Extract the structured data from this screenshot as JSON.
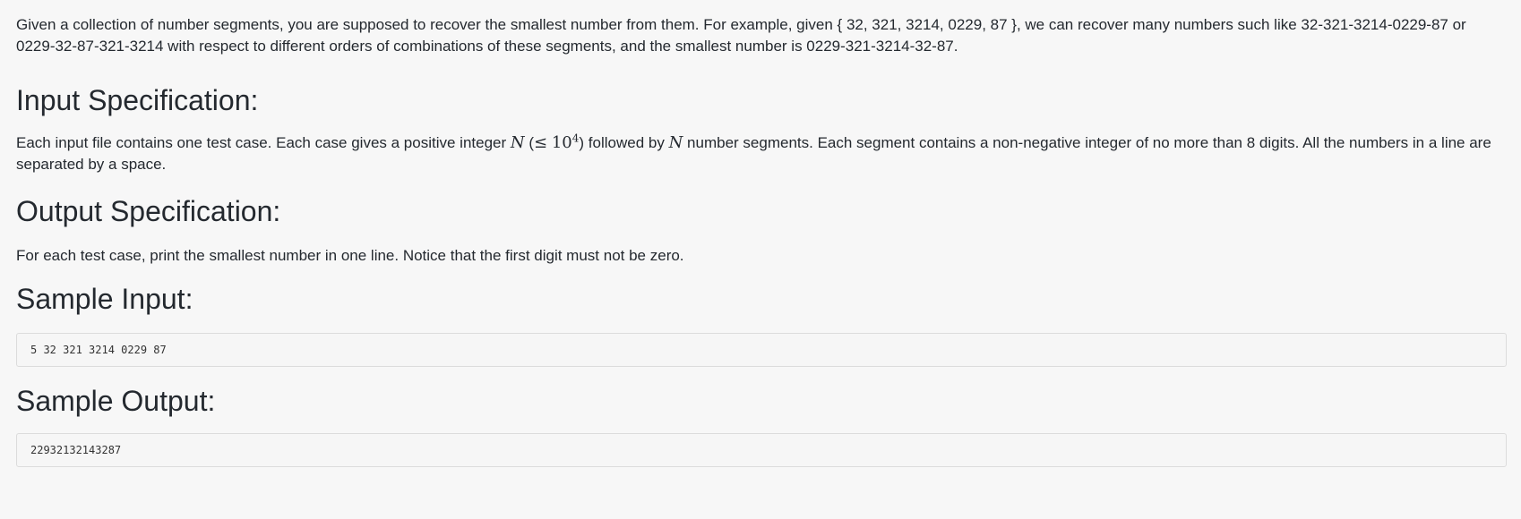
{
  "intro": "Given a collection of number segments, you are supposed to recover the smallest number from them. For example, given { 32, 321, 3214, 0229, 87 }, we can recover many numbers such like 32-321-3214-0229-87 or 0229-32-87-321-3214 with respect to different orders of combinations of these segments, and the smallest number is 0229-321-3214-32-87.",
  "input_spec": {
    "heading": "Input Specification:",
    "text_before_n": "Each input file contains one test case. Each case gives a positive integer ",
    "n_symbol": "N",
    "constraint_open": " (",
    "leq_symbol": "≤",
    "power_base": "10",
    "power_exponent": "4",
    "constraint_close": ")",
    "text_after_constraint": " followed by ",
    "n_symbol_2": "N",
    "text_rest": " number segments. Each segment contains a non-negative integer of no more than 8 digits. All the numbers in a line are separated by a space."
  },
  "output_spec": {
    "heading": "Output Specification:",
    "text": "For each test case, print the smallest number in one line. Notice that the first digit must not be zero."
  },
  "sample_input": {
    "heading": "Sample Input:",
    "code": "5 32 321 3214 0229 87"
  },
  "sample_output": {
    "heading": "Sample Output:",
    "code": "22932132143287"
  }
}
